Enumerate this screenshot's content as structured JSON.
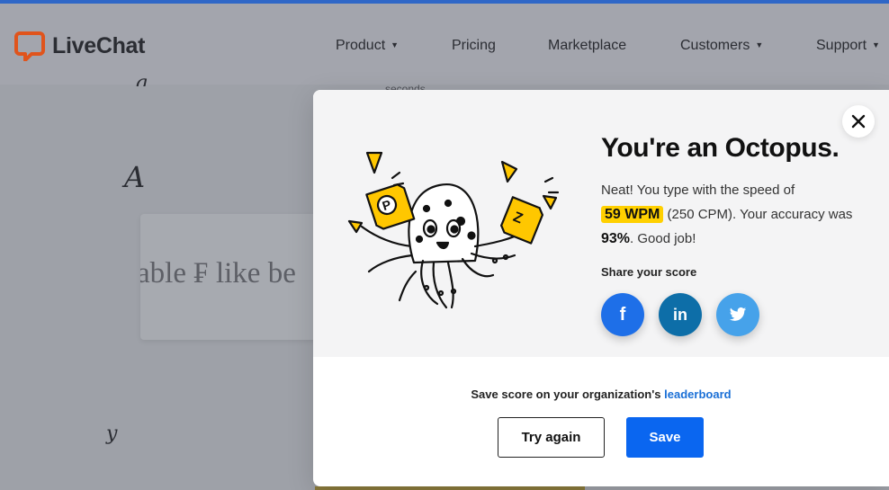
{
  "header": {
    "brand": "LiveChat",
    "nav": [
      {
        "label": "Product",
        "has_caret": true
      },
      {
        "label": "Pricing",
        "has_caret": false
      },
      {
        "label": "Marketplace",
        "has_caret": false
      },
      {
        "label": "Customers",
        "has_caret": true
      },
      {
        "label": "Support",
        "has_caret": true
      }
    ],
    "caret_glyph": "▼"
  },
  "background": {
    "typing_text": "able ₣ like be",
    "seconds_label": "seconds"
  },
  "modal": {
    "title": "You're an Octopus.",
    "desc_prefix": "Neat! You type with the speed of",
    "wpm": "59 WPM",
    "cpm_text": "(250 CPM). Your accuracy was",
    "accuracy": "93%",
    "desc_suffix": ". Good job!",
    "share_label": "Share your score",
    "social": [
      {
        "name": "facebook",
        "glyph": "f"
      },
      {
        "name": "linkedin",
        "glyph": "in"
      },
      {
        "name": "twitter",
        "glyph": "twitter-bird-icon"
      }
    ],
    "save_prompt": "Save score on your organization's",
    "save_link": "leaderboard",
    "try_again_label": "Try again",
    "save_label": "Save"
  },
  "colors": {
    "accent_blue": "#0a66f0",
    "highlight_yellow": "#ffd000",
    "facebook": "#1e6fe8",
    "linkedin": "#0d6ea8",
    "twitter": "#46a2ea",
    "brand_orange": "#e0541c"
  }
}
